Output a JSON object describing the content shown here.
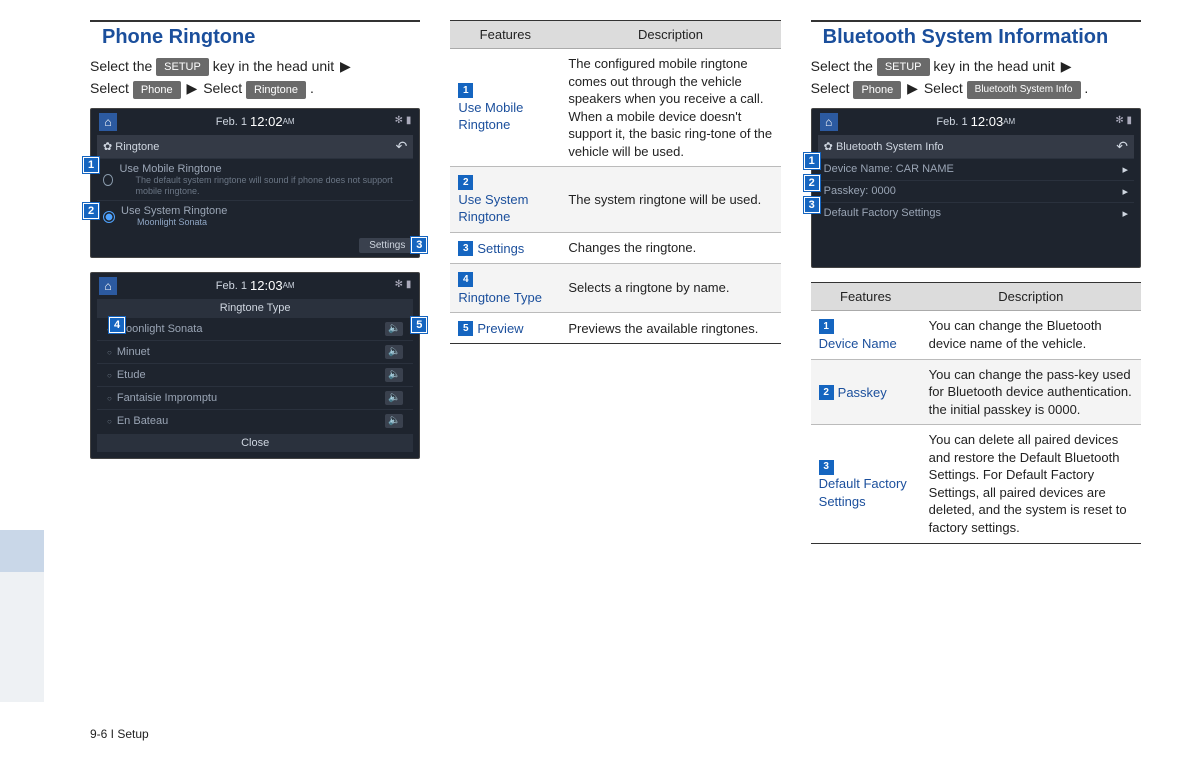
{
  "page_footer": "9-6 I Setup",
  "arrow_glyph": "▶",
  "col1": {
    "title": "Phone Ringtone",
    "instr_parts": {
      "p1": "Select the ",
      "k1": "SETUP",
      "p2": " key in the head unit ",
      "p3": "Select ",
      "k2": "Phone",
      "p4": " Select ",
      "k3": "Ringtone",
      "p5": " ."
    },
    "shot1": {
      "date": "Feb.  1",
      "time": "12:02",
      "ampm": "AM",
      "subtitle": "Ringtone",
      "row1": "Use Mobile Ringtone",
      "row1_sub": "The default system ringtone will sound if phone does not support mobile ringtone.",
      "row2": "Use System Ringtone",
      "row2_sub": "Moonlight Sonata",
      "settings": "Settings"
    },
    "shot2": {
      "date": "Feb.  1",
      "time": "12:03",
      "ampm": "AM",
      "header": "Ringtone Type",
      "items": [
        "Moonlight Sonata",
        "Minuet",
        "Etude",
        "Fantaisie Impromptu",
        "En Bateau"
      ],
      "close": "Close"
    }
  },
  "col2": {
    "table_head": {
      "f": "Features",
      "d": "Description"
    },
    "rows": [
      {
        "n": "1",
        "name": "Use Mobile Ringtone",
        "desc": "The configured mobile ringtone comes out through the vehicle speakers when you receive a call. When a mobile device doesn't support it, the basic ring-tone of the vehicle will be used."
      },
      {
        "n": "2",
        "name": "Use System Ringtone",
        "desc": "The system ringtone will be used."
      },
      {
        "n": "3",
        "name": "Settings",
        "desc": "Changes the ringtone."
      },
      {
        "n": "4",
        "name": "Ringtone Type",
        "desc": "Selects a ringtone by name."
      },
      {
        "n": "5",
        "name": "Preview",
        "desc": "Previews the available ringtones."
      }
    ]
  },
  "col3": {
    "title": "Bluetooth System Information",
    "instr_parts": {
      "p1": "Select the ",
      "k1": "SETUP",
      "p2": " key in the head unit ",
      "p3": "Select ",
      "k2": "Phone",
      "p4": " Select ",
      "k3": "Bluetooth System Info",
      "p5": " ."
    },
    "shot": {
      "date": "Feb.  1",
      "time": "12:03",
      "ampm": "AM",
      "subtitle": "Bluetooth System Info",
      "row1": "Device Name: CAR NAME",
      "row2": "Passkey: 0000",
      "row3": "Default Factory Settings"
    },
    "table_head": {
      "f": "Features",
      "d": "Description"
    },
    "rows": [
      {
        "n": "1",
        "name": "Device Name",
        "desc": "You can change the Bluetooth device name of the vehicle."
      },
      {
        "n": "2",
        "name": "Passkey",
        "desc": "You can change the pass-key used for Bluetooth device authentication. the initial passkey is 0000."
      },
      {
        "n": "3",
        "name": "Default Factory Settings",
        "desc": "You can delete all paired devices and restore the Default Bluetooth Settings. For Default Factory Settings, all paired devices are deleted, and the system is reset to factory settings."
      }
    ]
  }
}
